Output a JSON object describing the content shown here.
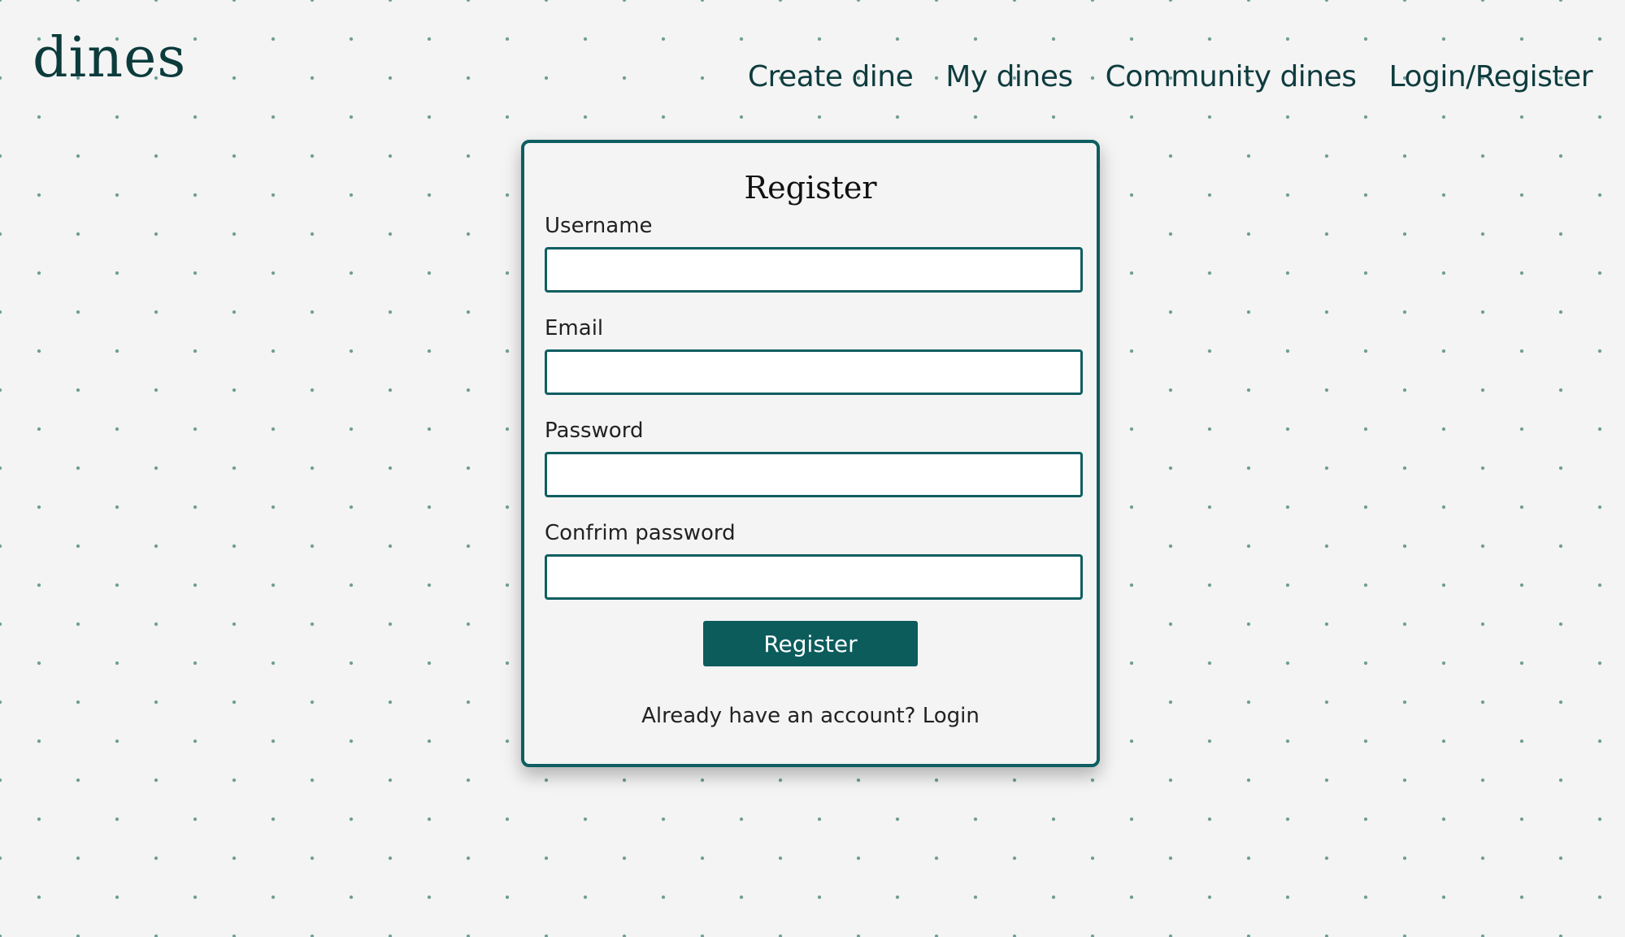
{
  "logo": "dines",
  "nav": {
    "items": [
      {
        "label": "Create dine"
      },
      {
        "label": "My dines"
      },
      {
        "label": "Community dines"
      },
      {
        "label": "Login/Register"
      }
    ]
  },
  "form": {
    "title": "Register",
    "fields": [
      {
        "label": "Username",
        "value": "",
        "placeholder": ""
      },
      {
        "label": "Email",
        "value": "",
        "placeholder": ""
      },
      {
        "label": "Password",
        "value": "",
        "placeholder": ""
      },
      {
        "label": "Confrim password",
        "value": "",
        "placeholder": ""
      }
    ],
    "submit_label": "Register",
    "login_prompt": "Already have an account?",
    "login_link": "Login"
  },
  "colors": {
    "accent": "#0c5c5c",
    "background": "#f4f4f4",
    "dots": "#6e9d94"
  }
}
